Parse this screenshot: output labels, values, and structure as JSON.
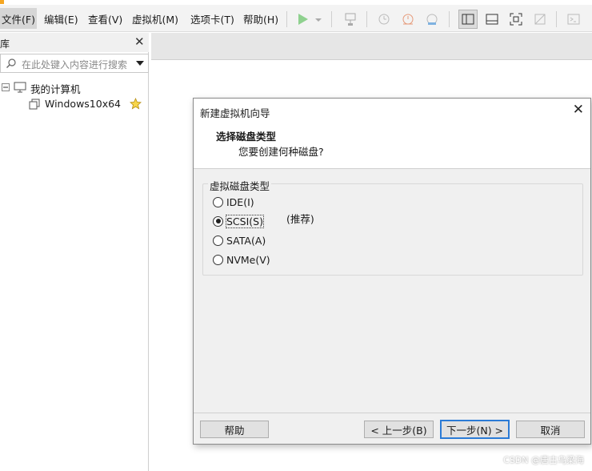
{
  "menu": {
    "file": "文件(F)",
    "edit": "编辑(E)",
    "view": "查看(V)",
    "vm": "虚拟机(M)",
    "tabs": "选项卡(T)",
    "help": "帮助(H)"
  },
  "library": {
    "title": "库",
    "search_placeholder": "在此处键入内容进行搜索",
    "root": "我的计算机",
    "vm_name": "Windows10x64"
  },
  "dialog": {
    "title": "新建虚拟机向导",
    "heading": "选择磁盘类型",
    "subheading": "您要创建何种磁盘?",
    "group_label": "虚拟磁盘类型",
    "options": [
      {
        "label": "IDE(I)",
        "checked": false
      },
      {
        "label": "SCSI(S)",
        "checked": true
      },
      {
        "label": "SATA(A)",
        "checked": false
      },
      {
        "label": "NVMe(V)",
        "checked": false
      }
    ],
    "recommended": "(推荐)",
    "buttons": {
      "help": "帮助",
      "back": "< 上一步(B)",
      "next": "下一步(N) >",
      "cancel": "取消"
    }
  },
  "watermark": "CSDN @唐古乌梁海",
  "colors": {
    "accent": "#2b7bd6",
    "play_green": "#4caf50",
    "orange": "#f5a623"
  }
}
